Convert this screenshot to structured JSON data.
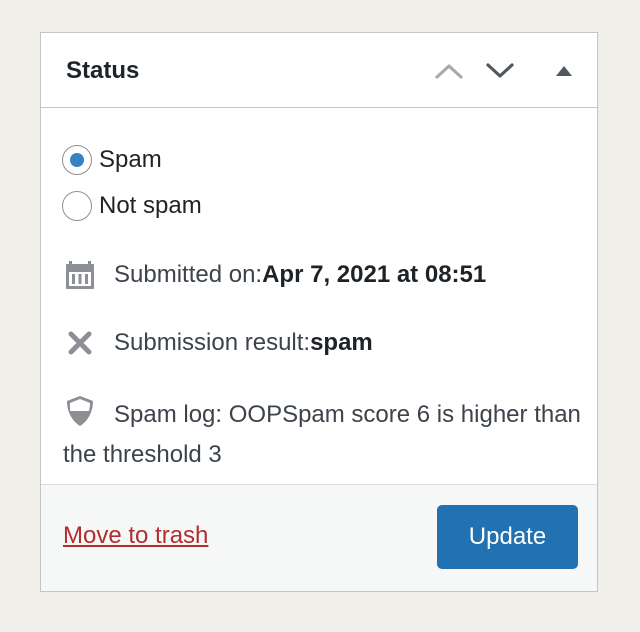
{
  "panel": {
    "title": "Status"
  },
  "header_controls": {
    "move_up_icon": "chevron-up-icon",
    "move_down_icon": "chevron-down-icon",
    "toggle_icon": "triangle-up-icon"
  },
  "spam_status": {
    "options": [
      {
        "label": "Spam",
        "checked": true
      },
      {
        "label": "Not spam",
        "checked": false
      }
    ]
  },
  "submitted": {
    "icon": "calendar-icon",
    "label": "Submitted on: ",
    "value": "Apr 7, 2021 at 08:51"
  },
  "result": {
    "icon": "close-x-icon",
    "label": "Submission result: ",
    "value": "spam"
  },
  "spam_log": {
    "icon": "shield-icon",
    "text": "Spam log: OOPSpam score 6 is higher than the threshold 3"
  },
  "footer": {
    "trash_label": "Move to trash",
    "update_label": "Update"
  },
  "colors": {
    "primary": "#2271b1",
    "danger": "#b32d2e",
    "radio_checked": "#3582c4",
    "background": "#f1efe9"
  }
}
